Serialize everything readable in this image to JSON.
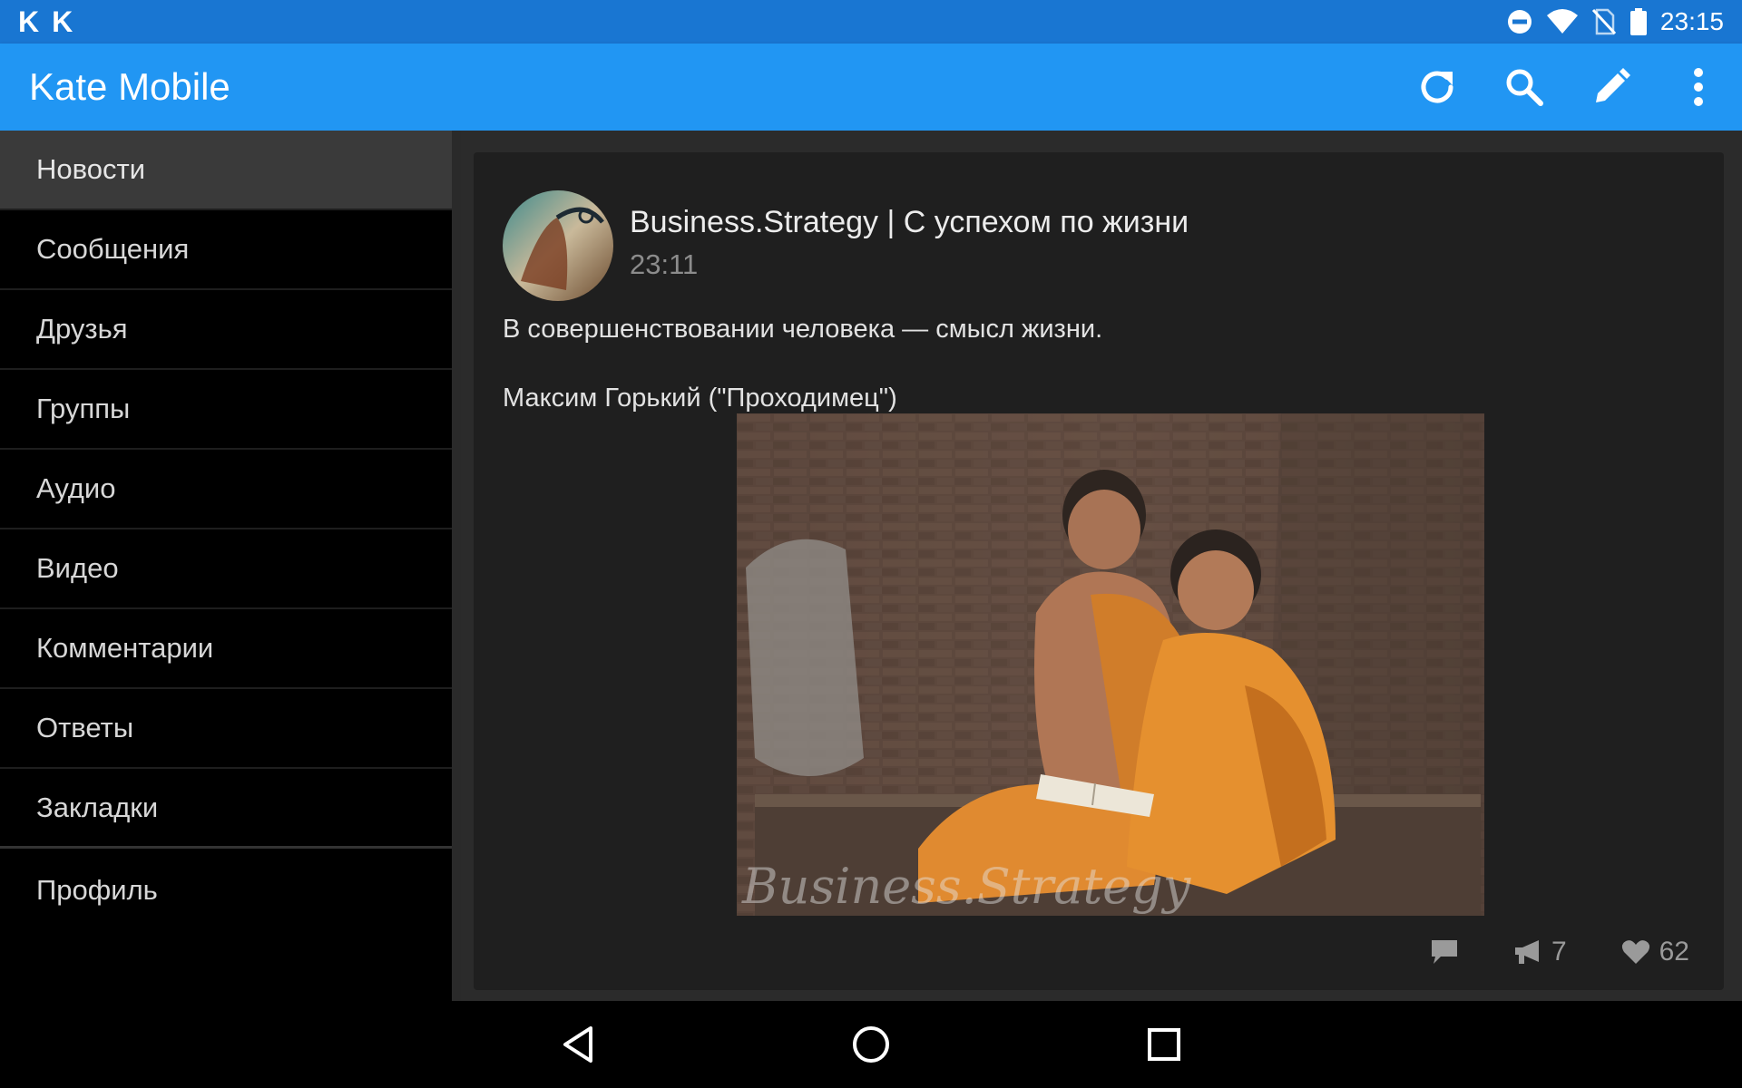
{
  "status_bar": {
    "left_icons": [
      "K",
      "K"
    ],
    "time": "23:15",
    "icons": [
      "do-not-disturb-icon",
      "wifi-icon",
      "no-sim-icon",
      "battery-icon"
    ]
  },
  "app_bar": {
    "title": "Kate Mobile",
    "actions": [
      "refresh-icon",
      "search-icon",
      "edit-icon",
      "more-vert-icon"
    ],
    "color": "#2196f3"
  },
  "sidebar": {
    "items": [
      {
        "label": "Новости",
        "active": true
      },
      {
        "label": "Сообщения"
      },
      {
        "label": "Друзья"
      },
      {
        "label": "Группы"
      },
      {
        "label": "Аудио"
      },
      {
        "label": "Видео"
      },
      {
        "label": "Комментарии"
      },
      {
        "label": "Ответы"
      },
      {
        "label": "Закладки"
      },
      {
        "label": "Профиль"
      }
    ]
  },
  "post": {
    "author": "Business.Strategy | С успехом по жизни",
    "time": "23:11",
    "text_line1": "В совершенствовании человека — смысл жизни.",
    "text_line2": "Максим Горький (\"Проходимец\")",
    "image_watermark": "Business.Strategy",
    "reposts": "7",
    "likes": "62"
  },
  "nav_bar": {
    "buttons": [
      "back-icon",
      "home-icon",
      "recents-icon"
    ]
  }
}
